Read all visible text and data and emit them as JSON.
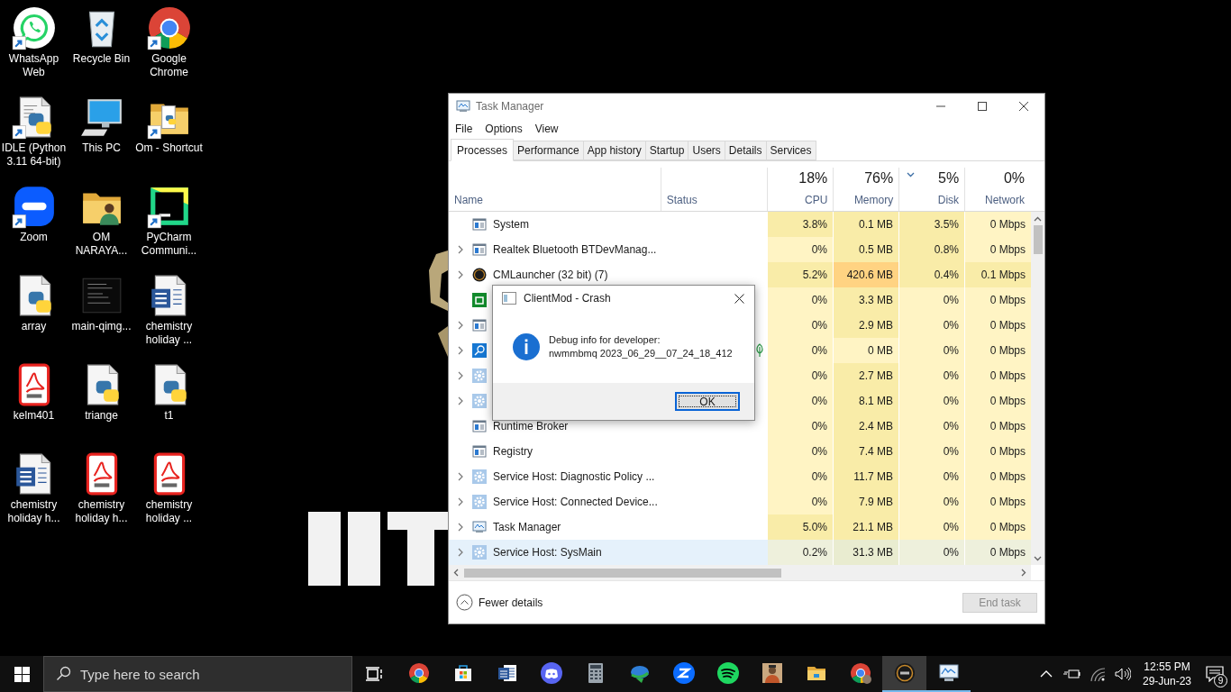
{
  "desktop_icons": [
    {
      "label": "WhatsApp Web",
      "kind": "whatsapp",
      "shortcut": true
    },
    {
      "label": "Recycle Bin",
      "kind": "recycle",
      "shortcut": false
    },
    {
      "label": "Google Chrome",
      "kind": "chrome",
      "shortcut": true
    },
    {
      "label": "IDLE (Python 3.11 64-bit)",
      "kind": "idle",
      "shortcut": true
    },
    {
      "label": "This PC",
      "kind": "pc",
      "shortcut": false
    },
    {
      "label": "Om - Shortcut",
      "kind": "folder-py",
      "shortcut": true
    },
    {
      "label": "Zoom",
      "kind": "zoom",
      "shortcut": true
    },
    {
      "label": "OM NARAYA...",
      "kind": "folder-user",
      "shortcut": false
    },
    {
      "label": "PyCharm Communi...",
      "kind": "pycharm",
      "shortcut": true
    },
    {
      "label": "array",
      "kind": "python",
      "shortcut": false
    },
    {
      "label": "main-qimg...",
      "kind": "image-dark",
      "shortcut": false
    },
    {
      "label": "chemistry holiday ...",
      "kind": "word",
      "shortcut": false
    },
    {
      "label": "kelm401",
      "kind": "pdf",
      "shortcut": false
    },
    {
      "label": "triange",
      "kind": "python",
      "shortcut": false
    },
    {
      "label": "t1",
      "kind": "python",
      "shortcut": false
    },
    {
      "label": "chemistry holiday h...",
      "kind": "word",
      "shortcut": false
    },
    {
      "label": "chemistry holiday h...",
      "kind": "pdf",
      "shortcut": false
    },
    {
      "label": "chemistry holiday ...",
      "kind": "pdf",
      "shortcut": false
    }
  ],
  "task_manager": {
    "title": "Task Manager",
    "menu": [
      "File",
      "Options",
      "View"
    ],
    "tabs": [
      {
        "label": "Processes",
        "selected": true
      },
      {
        "label": "Performance",
        "selected": false
      },
      {
        "label": "App history",
        "selected": false
      },
      {
        "label": "Startup",
        "selected": false
      },
      {
        "label": "Users",
        "selected": false
      },
      {
        "label": "Details",
        "selected": false
      },
      {
        "label": "Services",
        "selected": false
      }
    ],
    "columns": [
      {
        "label": "Name",
        "sorted": false
      },
      {
        "label": "Status",
        "sorted": false
      },
      {
        "label": "CPU",
        "usage": "18%",
        "sorted": false
      },
      {
        "label": "Memory",
        "usage": "76%",
        "sorted": false
      },
      {
        "label": "Disk",
        "usage": "5%",
        "sorted": true
      },
      {
        "label": "Network",
        "usage": "0%",
        "sorted": false
      }
    ],
    "rows": [
      {
        "kind": "app",
        "expandable": false,
        "eco": false,
        "selected": false,
        "cells": [
          {
            "text": "System"
          },
          {
            "text": ""
          },
          {
            "text": "3.8%",
            "color": "#f9eca8"
          },
          {
            "text": "0.1 MB",
            "color": "#f9eca8"
          },
          {
            "text": "3.5%",
            "color": "#f9eca8"
          },
          {
            "text": "0 Mbps",
            "color": "#fff4c4"
          }
        ]
      },
      {
        "kind": "app",
        "expandable": true,
        "eco": false,
        "selected": false,
        "cells": [
          {
            "text": "Realtek Bluetooth BTDevManag..."
          },
          {
            "text": ""
          },
          {
            "text": "0%",
            "color": "#fff4c4"
          },
          {
            "text": "0.5 MB",
            "color": "#f9eca8"
          },
          {
            "text": "0.8%",
            "color": "#f9eca8"
          },
          {
            "text": "0 Mbps",
            "color": "#fff4c4"
          }
        ]
      },
      {
        "kind": "cm",
        "expandable": true,
        "eco": false,
        "selected": false,
        "cells": [
          {
            "text": "CMLauncher (32 bit) (7)"
          },
          {
            "text": ""
          },
          {
            "text": "5.2%",
            "color": "#f9eca8"
          },
          {
            "text": "420.6 MB",
            "color": "#ffd382"
          },
          {
            "text": "0.4%",
            "color": "#f9eca8"
          },
          {
            "text": "0.1 Mbps",
            "color": "#f9eca8"
          }
        ]
      },
      {
        "kind": "green",
        "expandable": false,
        "eco": false,
        "selected": false,
        "cells": [
          {
            "text": ""
          },
          {
            "text": ""
          },
          {
            "text": "0%",
            "color": "#fff4c4"
          },
          {
            "text": "3.3 MB",
            "color": "#f9eca8"
          },
          {
            "text": "0%",
            "color": "#fff4c4"
          },
          {
            "text": "0 Mbps",
            "color": "#fff4c4"
          }
        ]
      },
      {
        "kind": "app",
        "expandable": true,
        "eco": false,
        "selected": false,
        "cells": [
          {
            "text": ""
          },
          {
            "text": ""
          },
          {
            "text": "0%",
            "color": "#fff4c4"
          },
          {
            "text": "2.9 MB",
            "color": "#f9eca8"
          },
          {
            "text": "0%",
            "color": "#fff4c4"
          },
          {
            "text": "0 Mbps",
            "color": "#fff4c4"
          }
        ]
      },
      {
        "kind": "search",
        "expandable": true,
        "eco": true,
        "selected": false,
        "cells": [
          {
            "text": ""
          },
          {
            "text": ""
          },
          {
            "text": "0%",
            "color": "#fff4c4"
          },
          {
            "text": "0 MB",
            "color": "#fff4c4"
          },
          {
            "text": "0%",
            "color": "#fff4c4"
          },
          {
            "text": "0 Mbps",
            "color": "#fff4c4"
          }
        ]
      },
      {
        "kind": "gear",
        "expandable": true,
        "eco": false,
        "selected": false,
        "cells": [
          {
            "text": ""
          },
          {
            "text": ""
          },
          {
            "text": "0%",
            "color": "#fff4c4"
          },
          {
            "text": "2.7 MB",
            "color": "#f9eca8"
          },
          {
            "text": "0%",
            "color": "#fff4c4"
          },
          {
            "text": "0 Mbps",
            "color": "#fff4c4"
          }
        ]
      },
      {
        "kind": "gear",
        "expandable": true,
        "eco": false,
        "selected": false,
        "cells": [
          {
            "text": ""
          },
          {
            "text": ""
          },
          {
            "text": "0%",
            "color": "#fff4c4"
          },
          {
            "text": "8.1 MB",
            "color": "#f9eca8"
          },
          {
            "text": "0%",
            "color": "#fff4c4"
          },
          {
            "text": "0 Mbps",
            "color": "#fff4c4"
          }
        ]
      },
      {
        "kind": "app",
        "expandable": false,
        "eco": false,
        "selected": false,
        "cells": [
          {
            "text": "Runtime Broker"
          },
          {
            "text": ""
          },
          {
            "text": "0%",
            "color": "#fff4c4"
          },
          {
            "text": "2.4 MB",
            "color": "#f9eca8"
          },
          {
            "text": "0%",
            "color": "#fff4c4"
          },
          {
            "text": "0 Mbps",
            "color": "#fff4c4"
          }
        ]
      },
      {
        "kind": "app",
        "expandable": false,
        "eco": false,
        "selected": false,
        "cells": [
          {
            "text": "Registry"
          },
          {
            "text": ""
          },
          {
            "text": "0%",
            "color": "#fff4c4"
          },
          {
            "text": "7.4 MB",
            "color": "#f9eca8"
          },
          {
            "text": "0%",
            "color": "#fff4c4"
          },
          {
            "text": "0 Mbps",
            "color": "#fff4c4"
          }
        ]
      },
      {
        "kind": "gear",
        "expandable": true,
        "eco": false,
        "selected": false,
        "cells": [
          {
            "text": "Service Host: Diagnostic Policy ..."
          },
          {
            "text": ""
          },
          {
            "text": "0%",
            "color": "#fff4c4"
          },
          {
            "text": "11.7 MB",
            "color": "#f9eca8"
          },
          {
            "text": "0%",
            "color": "#fff4c4"
          },
          {
            "text": "0 Mbps",
            "color": "#fff4c4"
          }
        ]
      },
      {
        "kind": "gear",
        "expandable": true,
        "eco": false,
        "selected": false,
        "cells": [
          {
            "text": "Service Host: Connected Device..."
          },
          {
            "text": ""
          },
          {
            "text": "0%",
            "color": "#fff4c4"
          },
          {
            "text": "7.9 MB",
            "color": "#f9eca8"
          },
          {
            "text": "0%",
            "color": "#fff4c4"
          },
          {
            "text": "0 Mbps",
            "color": "#fff4c4"
          }
        ]
      },
      {
        "kind": "taskmgr",
        "expandable": true,
        "eco": false,
        "selected": false,
        "cells": [
          {
            "text": "Task Manager"
          },
          {
            "text": ""
          },
          {
            "text": "5.0%",
            "color": "#f9eca8"
          },
          {
            "text": "21.1 MB",
            "color": "#f9eca8"
          },
          {
            "text": "0%",
            "color": "#fff4c4"
          },
          {
            "text": "0 Mbps",
            "color": "#fff4c4"
          }
        ]
      },
      {
        "kind": "gear",
        "expandable": true,
        "eco": false,
        "selected": true,
        "cells": [
          {
            "text": "Service Host: SysMain"
          },
          {
            "text": ""
          },
          {
            "text": "0.2%",
            "color": "#eef0dc"
          },
          {
            "text": "31.3 MB",
            "color": "#e9ecd0"
          },
          {
            "text": "0%",
            "color": "#eef0dc"
          },
          {
            "text": "0 Mbps",
            "color": "#eef0dc"
          }
        ]
      }
    ],
    "fewer_details": "Fewer details",
    "end_task": {
      "label": "End task",
      "disabled": true
    }
  },
  "dialog": {
    "title": "ClientMod - Crash",
    "message": [
      "Debug info for developer:",
      "nwmmbmq 2023_06_29__07_24_18_412"
    ],
    "button": "OK"
  },
  "taskbar": {
    "search_placeholder": "Type here to search",
    "apps": [
      {
        "kind": "chrome",
        "running": false,
        "focused": false
      },
      {
        "kind": "store",
        "running": false,
        "focused": false
      },
      {
        "kind": "word",
        "running": false,
        "focused": false
      },
      {
        "kind": "discord",
        "running": false,
        "focused": false
      },
      {
        "kind": "calculator",
        "running": false,
        "focused": false
      },
      {
        "kind": "idm",
        "running": false,
        "focused": false
      },
      {
        "kind": "zoom",
        "running": false,
        "focused": false
      },
      {
        "kind": "spotify",
        "running": false,
        "focused": false
      },
      {
        "kind": "game",
        "running": false,
        "focused": false
      },
      {
        "kind": "explorer",
        "running": false,
        "focused": false
      },
      {
        "kind": "chrome-profile",
        "running": false,
        "focused": false
      },
      {
        "kind": "cm",
        "running": true,
        "focused": true
      },
      {
        "kind": "taskmgr",
        "running": true,
        "focused": false
      }
    ],
    "time": "12:55 PM",
    "date": "29-Jun-23",
    "notification_count": "9"
  }
}
